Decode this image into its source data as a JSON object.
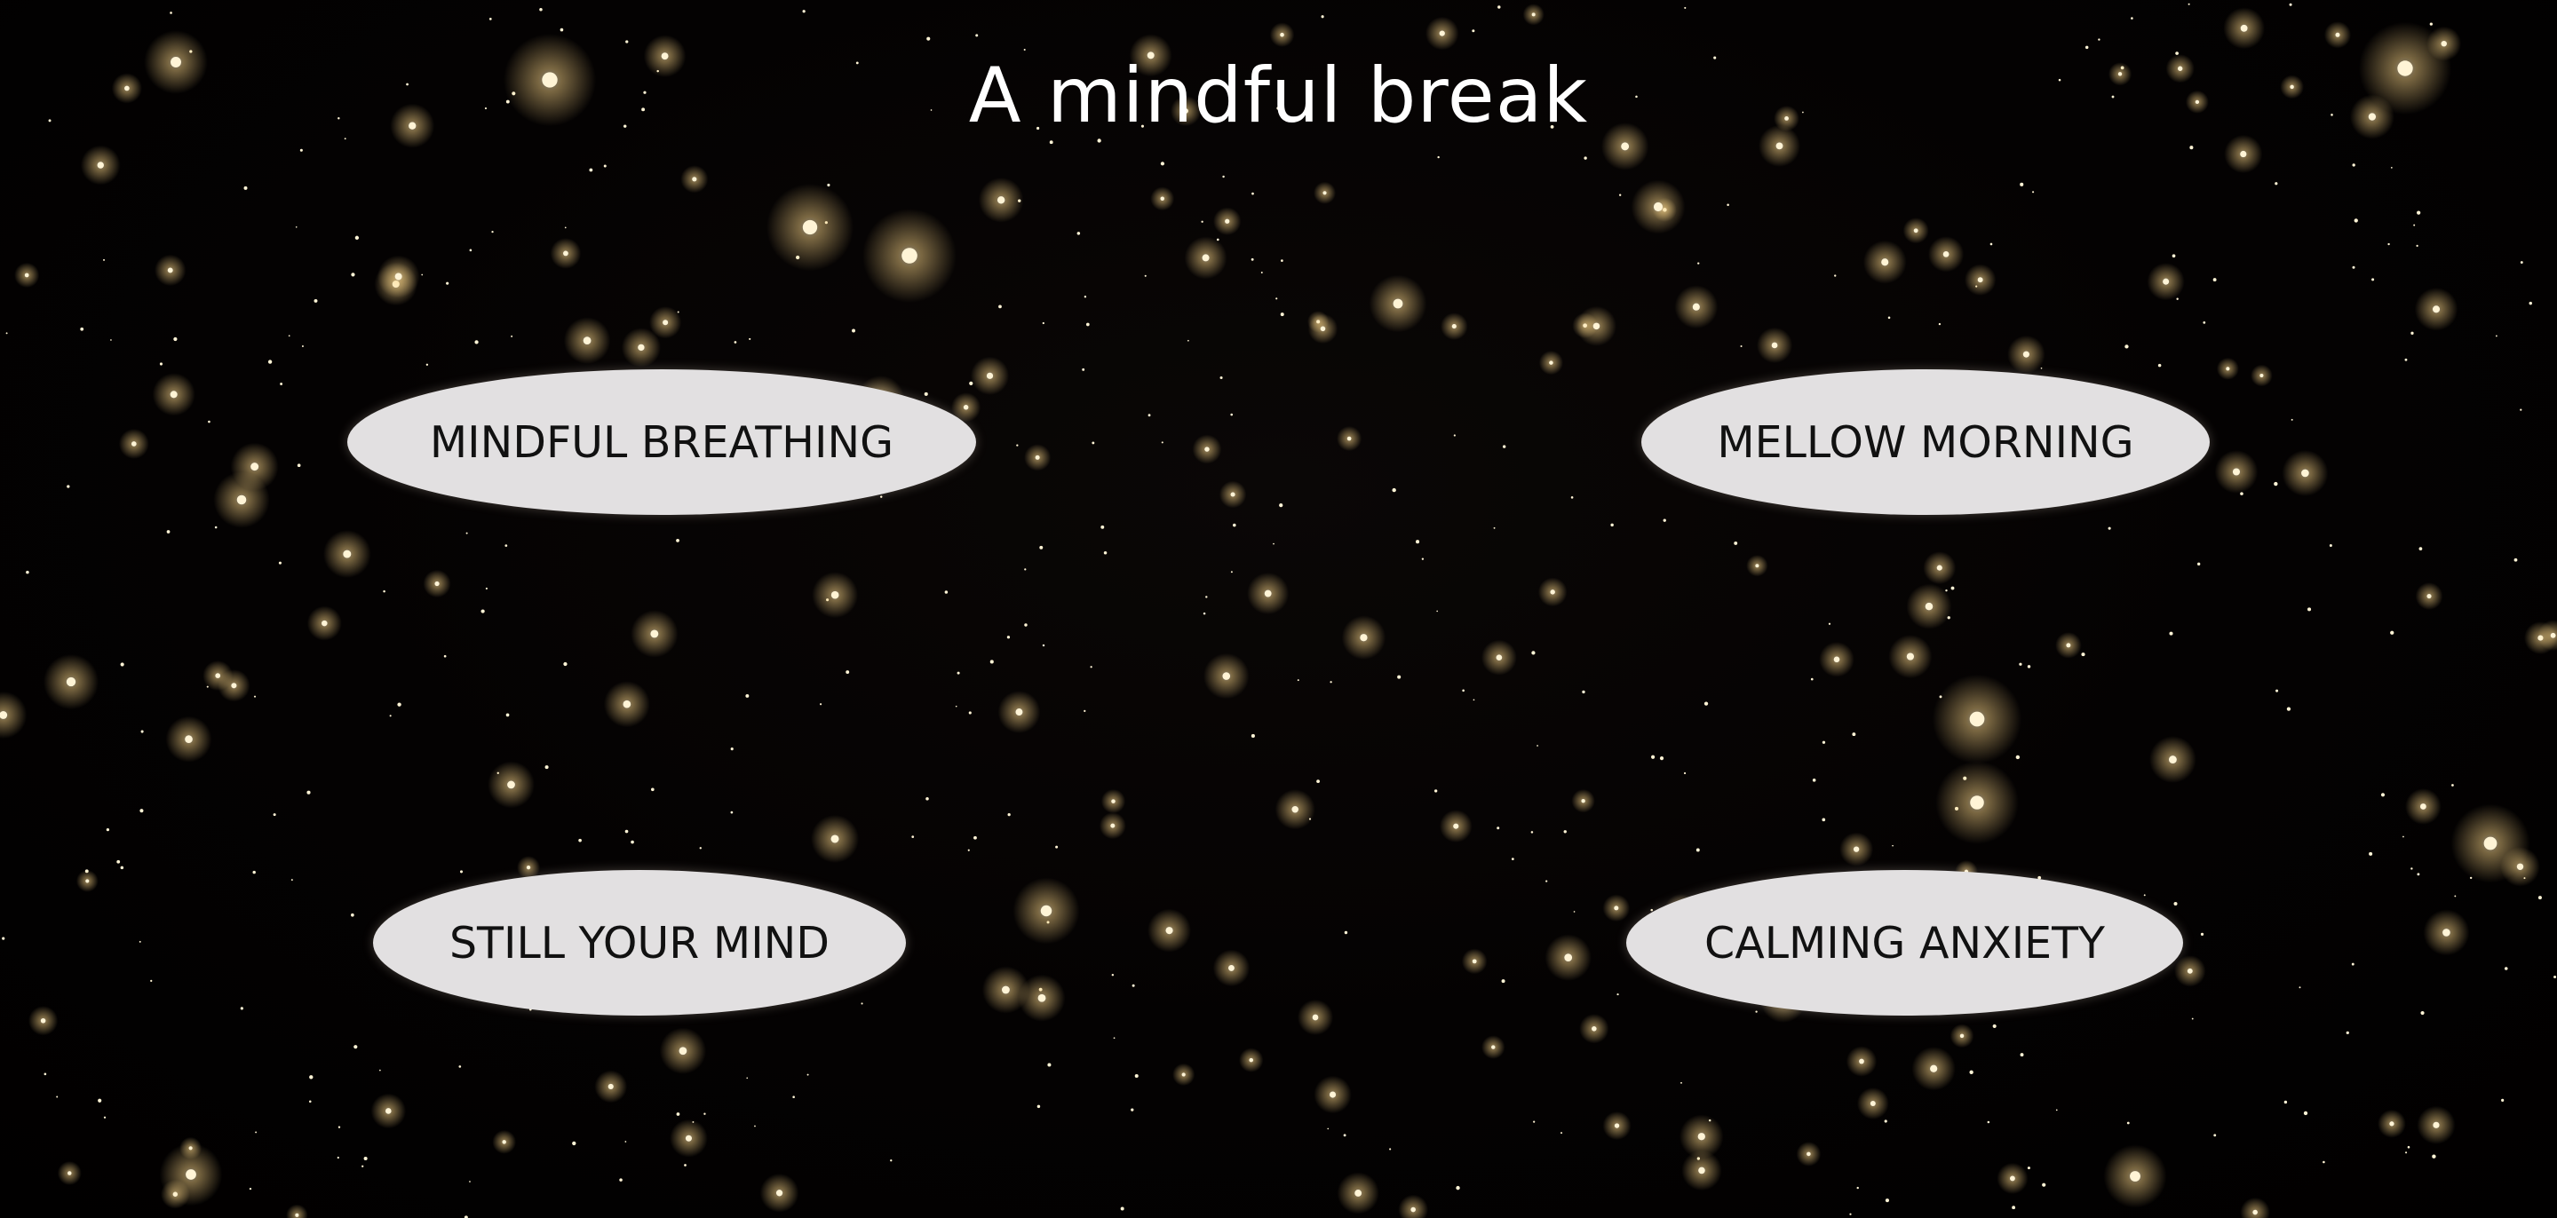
{
  "page": {
    "title": "A mindful break",
    "background": "starry-night-sky",
    "star_color": "#ffd98a"
  },
  "menu": {
    "items": [
      {
        "id": "mindful-breathing",
        "label": "MINDFUL BREATHING"
      },
      {
        "id": "mellow-morning",
        "label": "MELLOW MORNING"
      },
      {
        "id": "still-your-mind",
        "label": "STILL YOUR MIND"
      },
      {
        "id": "calming-anxiety",
        "label": "CALMING ANXIETY"
      }
    ],
    "button_color": "#e2e0e1",
    "label_color": "#111111"
  }
}
